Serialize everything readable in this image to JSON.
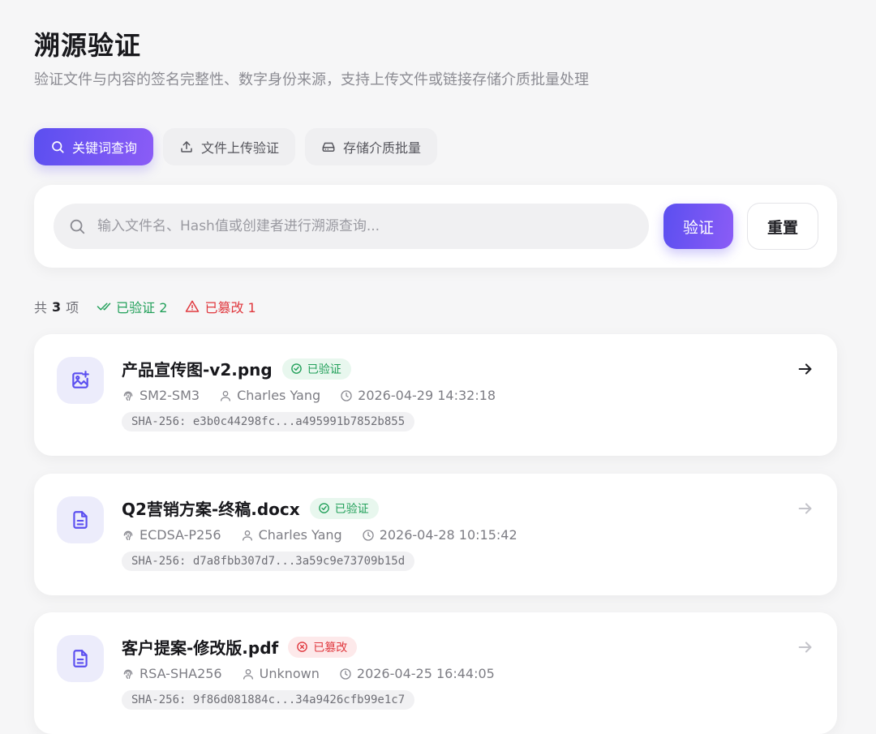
{
  "header": {
    "title": "溯源验证",
    "subtitle": "验证文件与内容的签名完整性、数字身份来源，支持上传文件或链接存储介质批量处理"
  },
  "tabs": [
    {
      "label": "关键词查询",
      "icon": "search-icon",
      "active": true
    },
    {
      "label": "文件上传验证",
      "icon": "upload-icon",
      "active": false
    },
    {
      "label": "存储介质批量",
      "icon": "hard-drive-icon",
      "active": false
    }
  ],
  "search": {
    "placeholder": "输入文件名、Hash值或创建者进行溯源查询...",
    "value": "",
    "verify_label": "验证",
    "reset_label": "重置"
  },
  "summary": {
    "total_prefix": "共",
    "total": "3",
    "total_suffix": "项",
    "verified": "已验证 2",
    "tampered": "已篡改 1"
  },
  "results": [
    {
      "name": "产品宣传图-v2.png",
      "icon": "image-plus-icon",
      "status": "已验证",
      "status_type": "ok",
      "algorithm": "SM2-SM3",
      "creator": "Charles Yang",
      "time": "2026-04-29 14:32:18",
      "hash": "SHA-256: e3b0c44298fc...a495991b7852b855",
      "highlighted": true
    },
    {
      "name": "Q2营销方案-终稿.docx",
      "icon": "document-icon",
      "status": "已验证",
      "status_type": "ok",
      "algorithm": "ECDSA-P256",
      "creator": "Charles Yang",
      "time": "2026-04-28 10:15:42",
      "hash": "SHA-256: d7a8fbb307d7...3a59c9e73709b15d",
      "highlighted": false
    },
    {
      "name": "客户提案-修改版.pdf",
      "icon": "document-icon",
      "status": "已篡改",
      "status_type": "bad",
      "algorithm": "RSA-SHA256",
      "creator": "Unknown",
      "time": "2026-04-25 16:44:05",
      "hash": "SHA-256: 9f86d081884c...34a9426cfb99e1c7",
      "highlighted": false
    }
  ],
  "colors": {
    "accent_start": "#5b4ff0",
    "accent_end": "#8b5cf6",
    "ok": "#22a05a",
    "bad": "#e0383e"
  }
}
